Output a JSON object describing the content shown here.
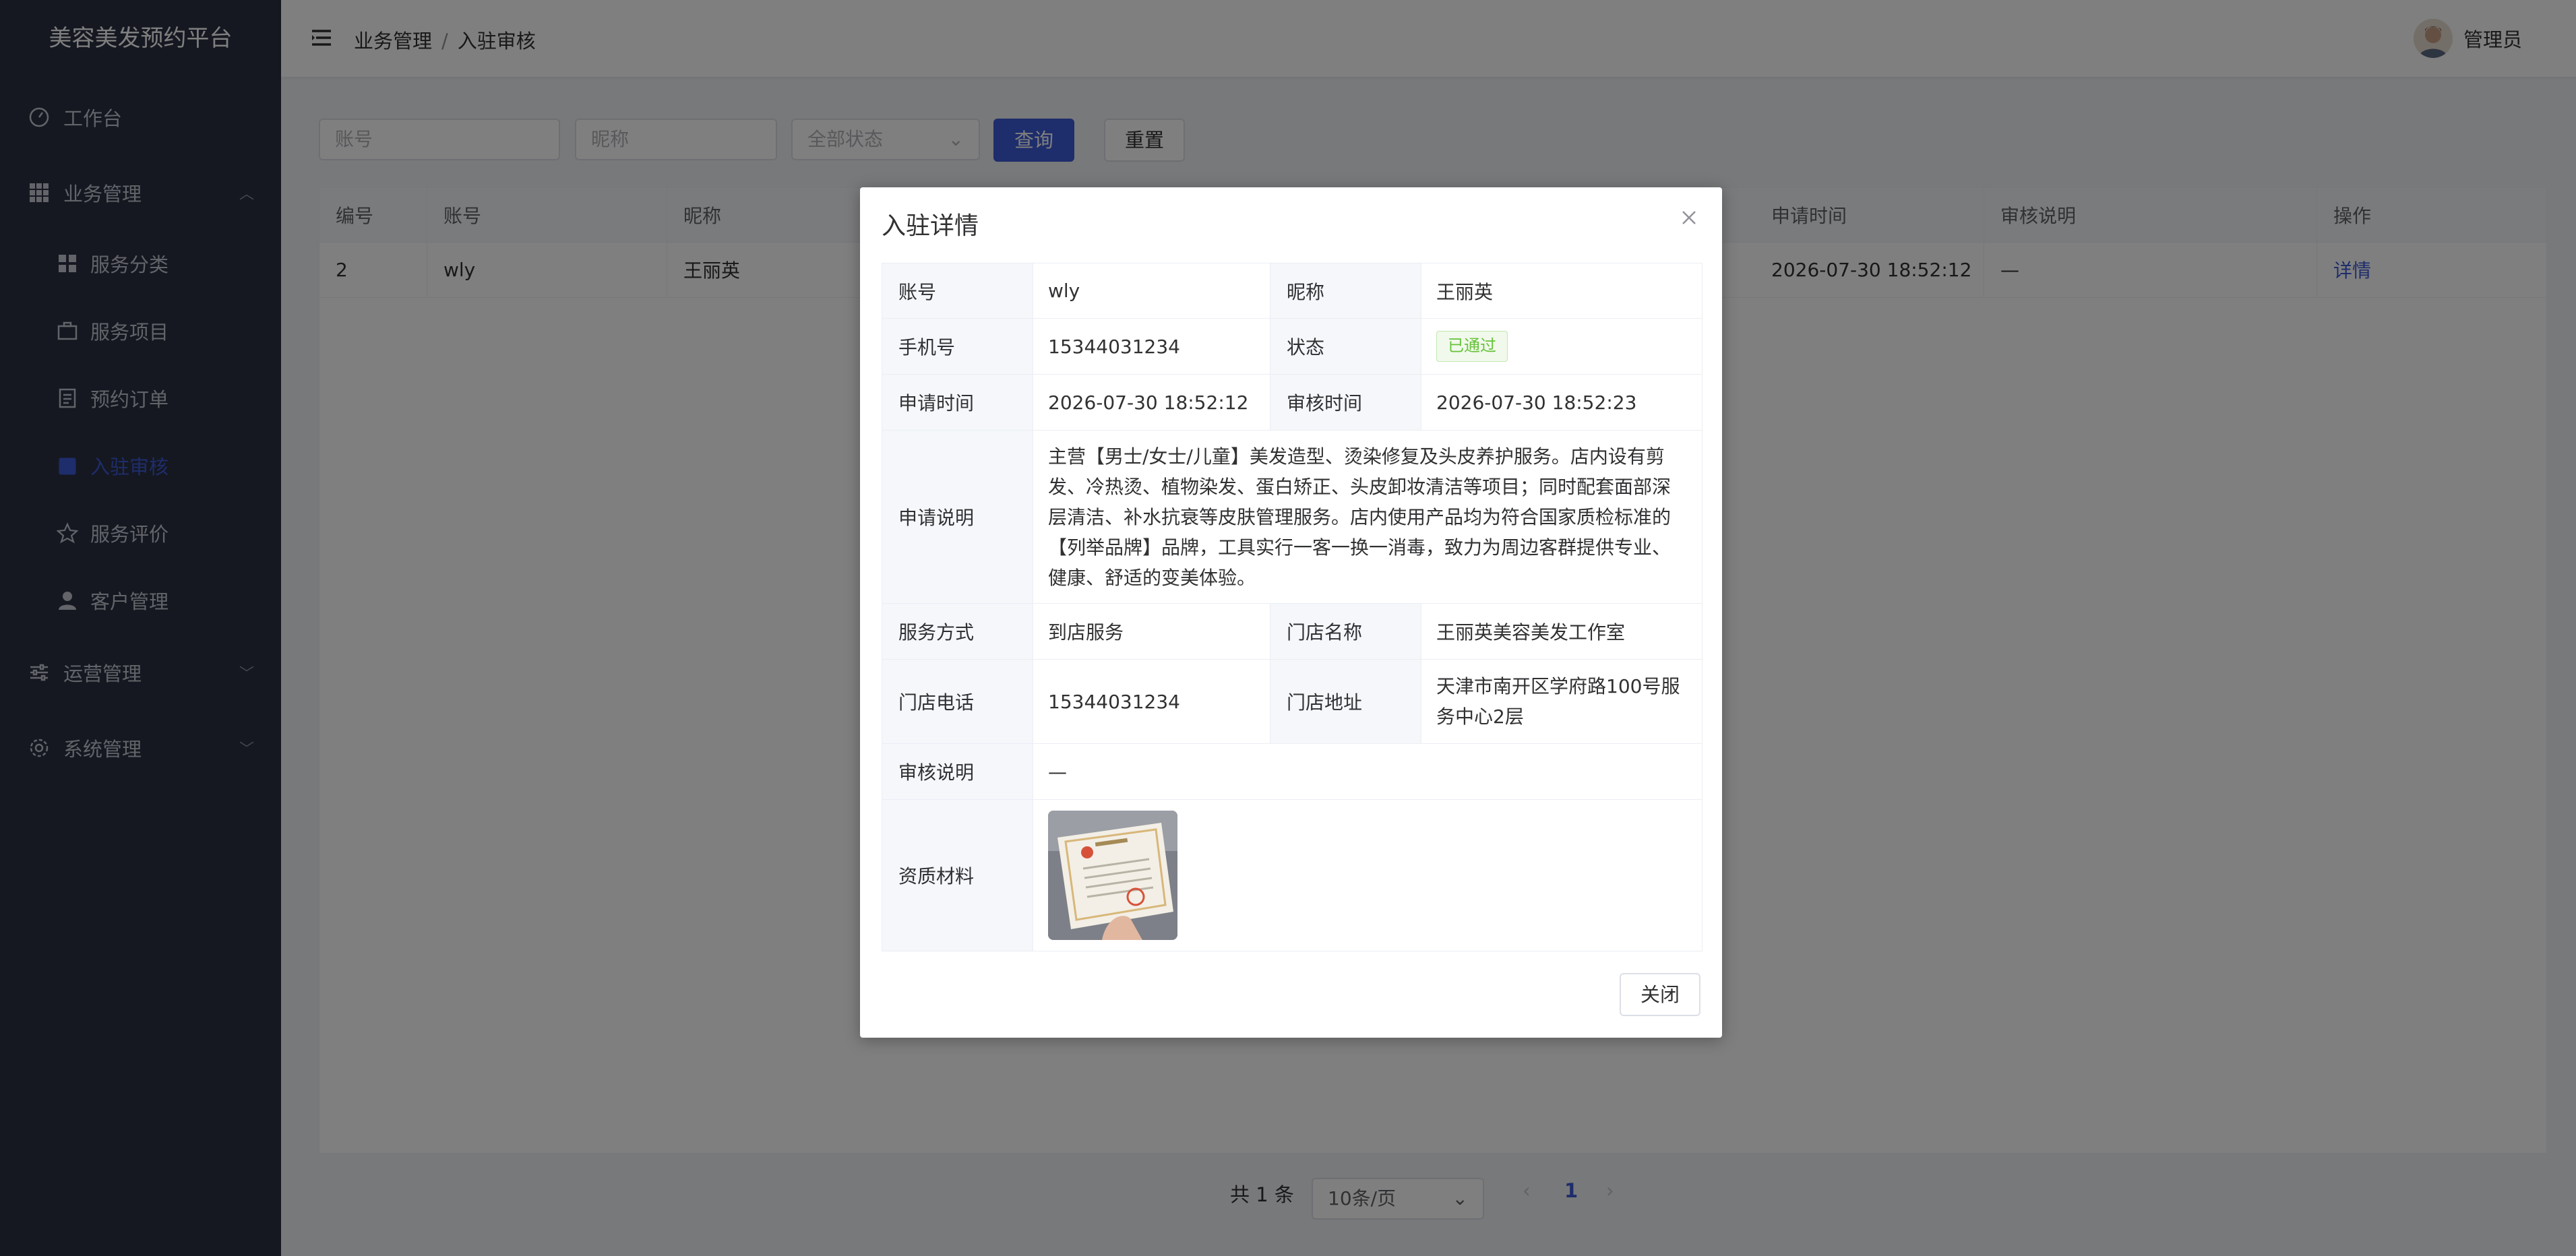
{
  "app": {
    "title": "美容美发预约平台"
  },
  "sidebar": {
    "items": [
      {
        "label": "工作台",
        "icon": "dashboard-icon"
      },
      {
        "label": "业务管理",
        "icon": "grid-icon"
      },
      {
        "label": "服务分类",
        "icon": "category-icon"
      },
      {
        "label": "服务项目",
        "icon": "briefcase-icon"
      },
      {
        "label": "预约订单",
        "icon": "document-icon"
      },
      {
        "label": "入驻审核",
        "icon": "checklist-icon",
        "active": true
      },
      {
        "label": "服务评价",
        "icon": "star-icon"
      },
      {
        "label": "客户管理",
        "icon": "user-icon"
      },
      {
        "label": "运营管理",
        "icon": "sliders-icon"
      },
      {
        "label": "系统管理",
        "icon": "gear-icon"
      }
    ]
  },
  "header": {
    "breadcrumb": [
      "业务管理",
      "入驻审核"
    ],
    "breadcrumb_sep": "/",
    "user": "管理员"
  },
  "filter": {
    "account_placeholder": "账号",
    "nickname_placeholder": "昵称",
    "status_value": "全部状态",
    "query_label": "查询",
    "reset_label": "重置"
  },
  "table": {
    "headers": [
      "编号",
      "账号",
      "昵称",
      "申请时间",
      "审核说明",
      "操作"
    ],
    "row": {
      "id": "2",
      "account": "wly",
      "nickname": "王丽英",
      "apply_time": "2026-07-30 18:52:12",
      "review_note": "—",
      "action": "详情"
    }
  },
  "pager": {
    "total": "共 1 条",
    "size": "10条/页",
    "page": "1"
  },
  "dialog": {
    "title": "入驻详情",
    "close_label": "关闭",
    "account_label": "账号",
    "account": "wly",
    "nickname_label": "昵称",
    "nickname": "王丽英",
    "phone_label": "手机号",
    "phone": "15344031234",
    "status_label": "状态",
    "status": "已通过",
    "apply_time_label": "申请时间",
    "apply_time": "2026-07-30 18:52:12",
    "review_time_label": "审核时间",
    "review_time": "2026-07-30 18:52:23",
    "desc_label": "申请说明",
    "desc": "主营【男士/女士/儿童】美发造型、烫染修复及头皮养护服务。店内设有剪发、冷热烫、植物染发、蛋白矫正、头皮卸妆清洁等项目；同时配套面部深层清洁、补水抗衰等皮肤管理服务。店内使用产品均为符合国家质检标准的【列举品牌】品牌，工具实行一客一换一消毒，致力为周边客群提供专业、健康、舒适的变美体验。",
    "service_mode_label": "服务方式",
    "service_mode": "到店服务",
    "store_name_label": "门店名称",
    "store_name": "王丽英美容美发工作室",
    "store_phone_label": "门店电话",
    "store_phone": "15344031234",
    "store_address_label": "门店地址",
    "store_address": "天津市南开区学府路100号服务中心2层",
    "review_note_label": "审核说明",
    "review_note": "—",
    "materials_label": "资质材料"
  }
}
